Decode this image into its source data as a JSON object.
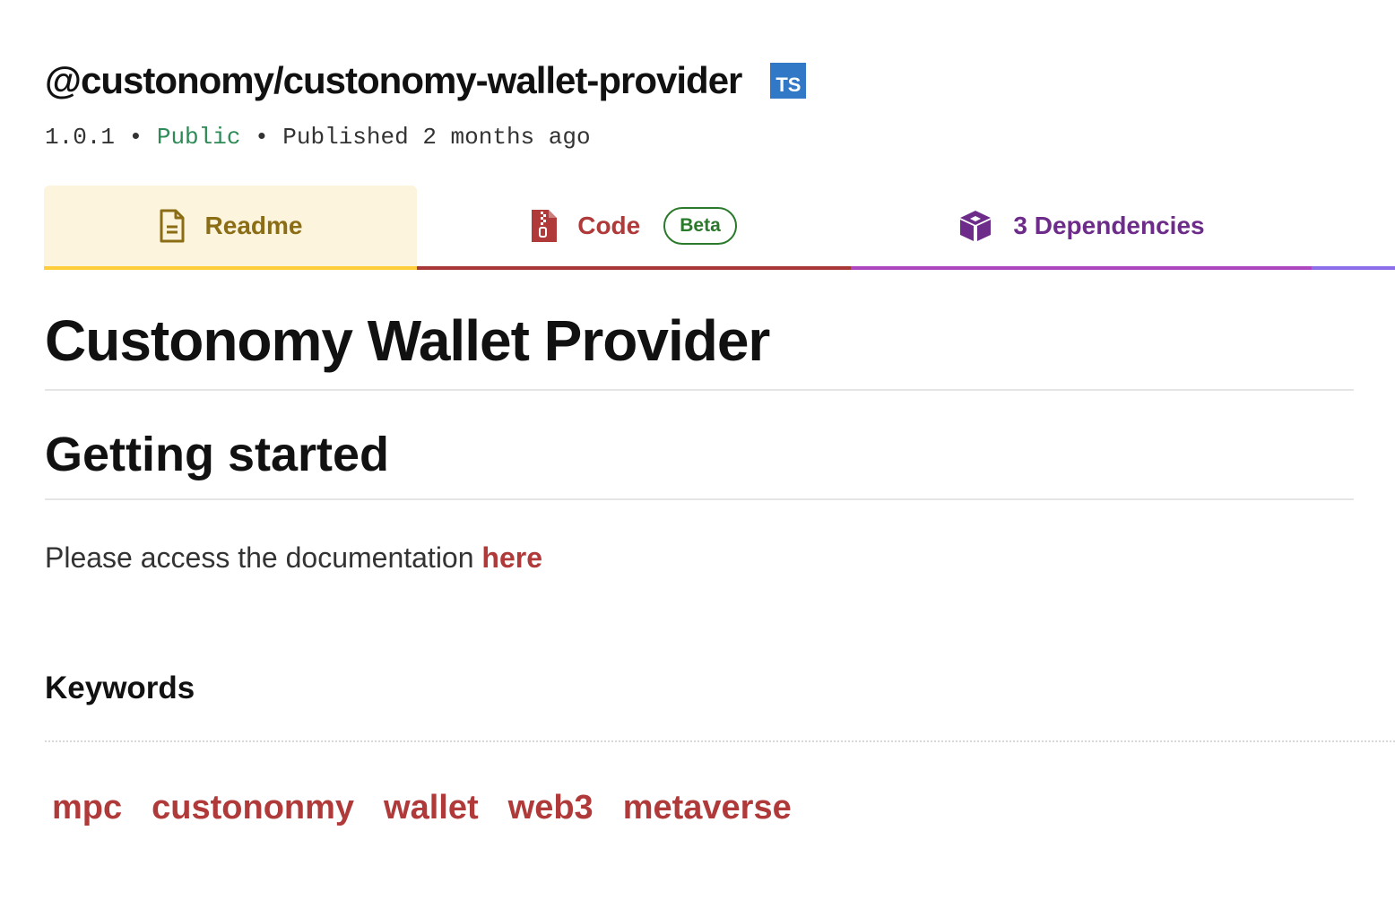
{
  "package": {
    "name": "@custonomy/custonomy-wallet-provider",
    "ts_badge": "TS",
    "version": "1.0.1",
    "separator": "•",
    "visibility": "Public",
    "published": "Published 2 months ago"
  },
  "tabs": [
    {
      "label": "Readme",
      "icon": "document-icon",
      "color": "#8b6d16"
    },
    {
      "label": "Code",
      "icon": "zip-file-icon",
      "color": "#b03a3a",
      "badge": "Beta"
    },
    {
      "label": "3 Dependencies",
      "icon": "box-icon",
      "color": "#6e2c8a"
    }
  ],
  "readme": {
    "title": "Custonomy Wallet Provider",
    "section_heading": "Getting started",
    "paragraph_text": "Please access the documentation ",
    "paragraph_link": "here"
  },
  "keywords": {
    "title": "Keywords",
    "items": [
      "mpc",
      "custononmy",
      "wallet",
      "web3",
      "metaverse"
    ]
  },
  "colors": {
    "ts_blue": "#3178c6",
    "public_green": "#2e8b57",
    "link_red": "#b03a3a",
    "readme_yellow": "#ffcd3a",
    "deps_purple": "#ad47c0"
  }
}
